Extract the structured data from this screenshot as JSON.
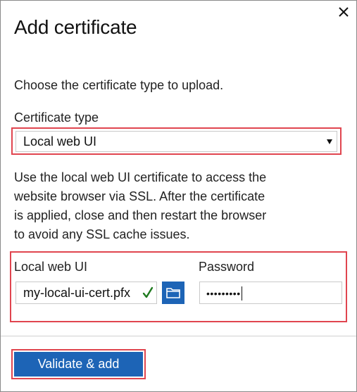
{
  "dialog": {
    "title": "Add certificate",
    "intro": "Choose the certificate type to upload.",
    "close_icon": "close-icon"
  },
  "certificate_type": {
    "label": "Certificate type",
    "selected": "Local web UI",
    "description_lines": [
      "Use the local web UI certificate to access the",
      "website browser via SSL. After the certificate",
      "is applied, close and then restart the browser",
      "to avoid any SSL cache issues."
    ]
  },
  "fields": {
    "local_web_ui_label": "Local web UI",
    "file_value": "my-local-ui-cert.pfx",
    "file_status_icon": "checkmark-icon",
    "browse_icon": "folder-icon",
    "password_label": "Password",
    "password_masked": "•••••••••"
  },
  "actions": {
    "validate_label": "Validate & add"
  },
  "colors": {
    "accent": "#1d64b6",
    "highlight": "#e0454f",
    "check": "#1f7a1f"
  }
}
